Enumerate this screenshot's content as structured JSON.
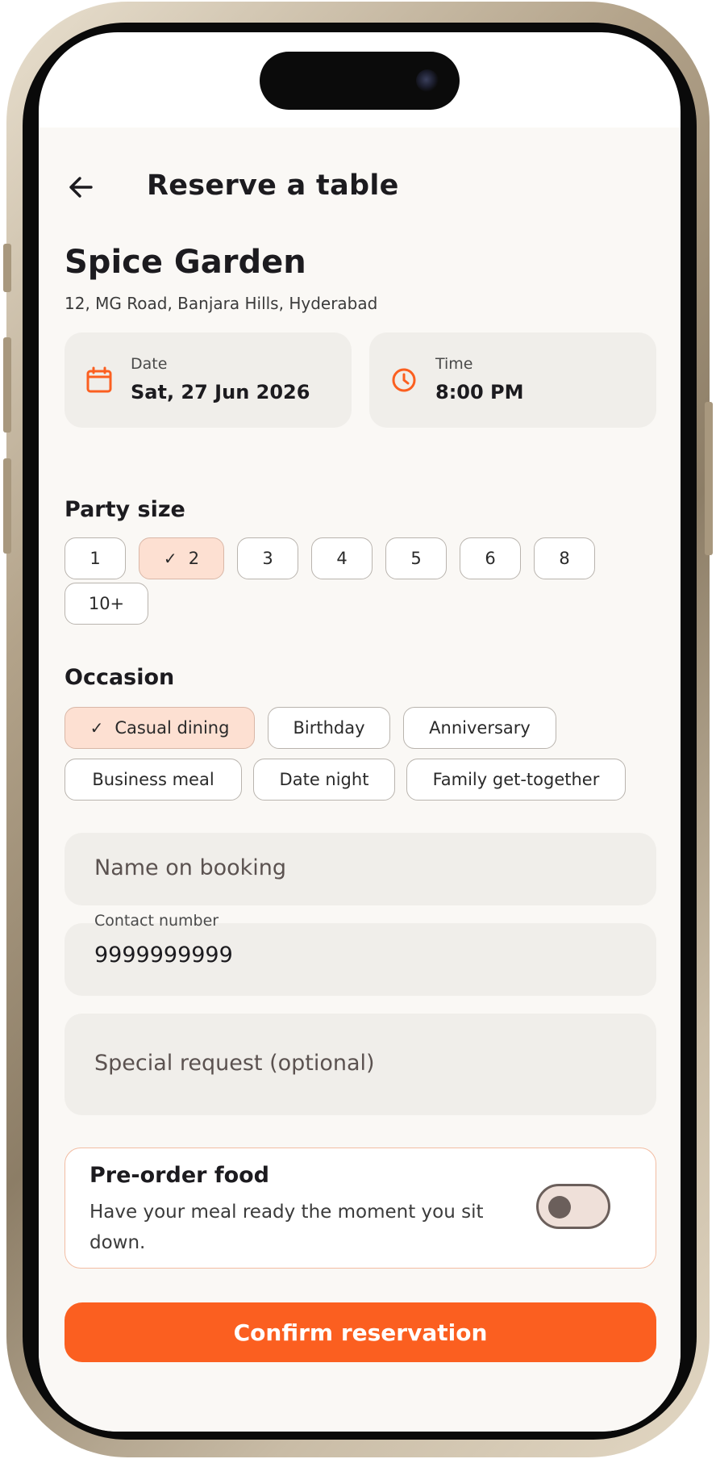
{
  "header": {
    "title": "Reserve a table"
  },
  "restaurant": {
    "name": "Spice Garden",
    "address": "12, MG Road, Banjara Hills, Hyderabad"
  },
  "date": {
    "label": "Date",
    "value": "Sat, 27 Jun 2026",
    "icon": "calendar-icon"
  },
  "time": {
    "label": "Time",
    "value": "8:00 PM",
    "icon": "clock-icon"
  },
  "party_size": {
    "title": "Party size",
    "options": [
      "1",
      "2",
      "3",
      "4",
      "5",
      "6",
      "8",
      "10+"
    ],
    "selected": "2"
  },
  "occasion": {
    "title": "Occasion",
    "options": [
      "Casual dining",
      "Birthday",
      "Anniversary",
      "Business meal",
      "Date night",
      "Family get-together"
    ],
    "selected": "Casual dining"
  },
  "form": {
    "name_placeholder": "Name on booking",
    "contact_label": "Contact number",
    "contact_value": "9999999999",
    "special_placeholder": "Special request (optional)"
  },
  "preorder": {
    "title": "Pre-order food",
    "description": "Have your meal ready the moment you sit down.",
    "enabled": false
  },
  "confirm_label": "Confirm reservation",
  "colors": {
    "accent": "#fb5f20",
    "chip_selected": "#fde0d2",
    "background": "#faf8f5",
    "card": "#f0eeea"
  }
}
